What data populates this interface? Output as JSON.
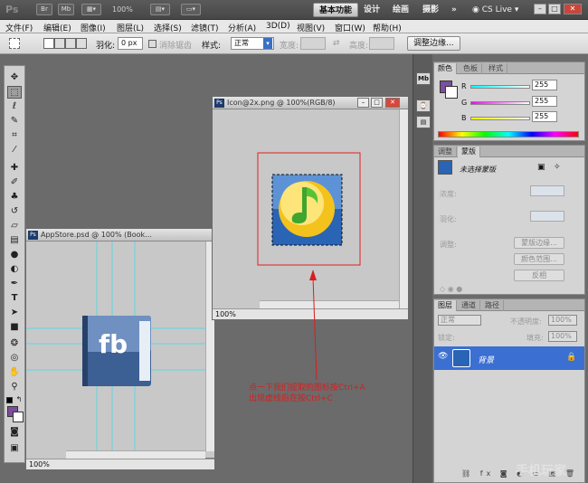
{
  "titlebar": {
    "app_icon": "Ps",
    "br_label": "Br",
    "mb_label": "Mb",
    "zoom": "100%",
    "workspaces": [
      "基本功能",
      "设计",
      "绘画",
      "摄影"
    ],
    "more": "»",
    "cslive": "CS Live"
  },
  "menu": [
    "文件(F)",
    "编辑(E)",
    "图像(I)",
    "图层(L)",
    "选择(S)",
    "滤镜(T)",
    "分析(A)",
    "3D(D)",
    "视图(V)",
    "窗口(W)",
    "帮助(H)"
  ],
  "options": {
    "feather_label": "羽化:",
    "feather_value": "0 px",
    "antialias_label": "消除锯齿",
    "style_label": "样式:",
    "style_value": "正常",
    "width_label": "宽度:",
    "height_label": "高度:",
    "refine_button": "调整边缘..."
  },
  "doc_icon": {
    "ps": "Ps",
    "title": "Icon@2x.png @ 100%(RGB/8)",
    "zoom": "100%"
  },
  "doc_appstore": {
    "ps": "Ps",
    "title": "AppStore.psd @ 100% (Book...",
    "zoom": "100%",
    "icon_text": "fb"
  },
  "color_panel": {
    "tabs": [
      "颜色",
      "色板",
      "样式"
    ],
    "r_label": "R",
    "g_label": "G",
    "b_label": "B",
    "r": "255",
    "g": "255",
    "b": "255",
    "fg_color": "#7b4f9a"
  },
  "adjust_panel": {
    "tabs": [
      "调整",
      "蒙版"
    ],
    "no_mask": "未选择蒙版",
    "density": "浓度:",
    "feather": "羽化:",
    "refine": "调整:",
    "mask_edge": "蒙版边缘...",
    "color_range": "颜色范围...",
    "invert": "反相"
  },
  "layers_panel": {
    "tabs": [
      "图层",
      "通道",
      "路径"
    ],
    "blend": "正常",
    "opacity_label": "不透明度:",
    "opacity": "100%",
    "lock_label": "锁定:",
    "fill_label": "填充:",
    "fill": "100%",
    "layer_name": "背景"
  },
  "annotation": [
    "点一下我们提取的图标按Ctrl+A",
    "出现虚线后在按Ctrl+C"
  ],
  "watermark": "手机玩家",
  "colors": {
    "annotation": "#d81e1e",
    "selected_layer": "#3b6fd1",
    "icon_bg": "#2a64b4"
  }
}
